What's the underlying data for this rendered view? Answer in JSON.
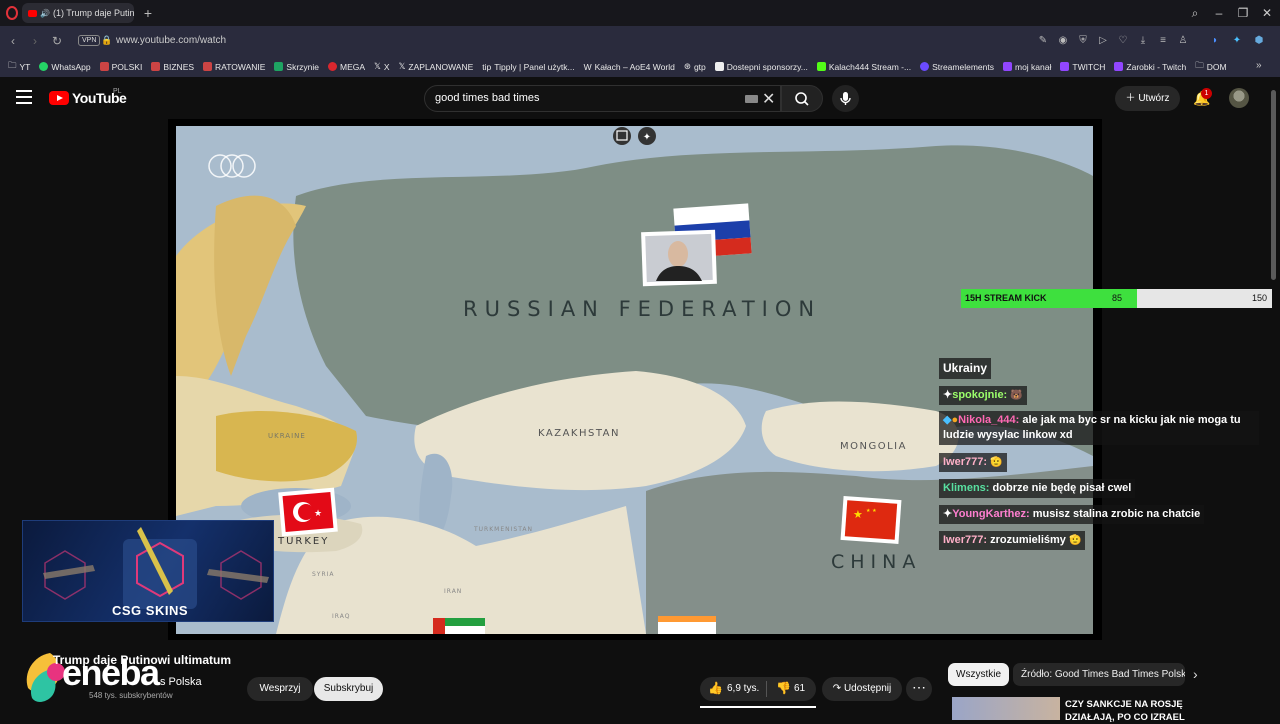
{
  "browser": {
    "tab_title": "(1) Trump daje Putino",
    "url": "www.youtube.com/watch",
    "vpn_label": "VPN",
    "bookmarks": [
      "YT",
      "WhatsApp",
      "POLSKI",
      "BIZNES",
      "RATOWANIE",
      "Skrzynie",
      "MEGA",
      "X",
      "ZAPLANOWANE",
      "Tipply | Panel użytk...",
      "Kałach – AoE4 World",
      "gtp",
      "Dostepni sponsorzy...",
      "Kalach444 Stream -...",
      "Streamelements",
      "moj kanał",
      "TWITCH",
      "Zarobki - Twitch",
      "DOM"
    ]
  },
  "youtube": {
    "logo_text": "YouTube",
    "region": "PL",
    "search_query": "good times bad times",
    "create_label": "Utwórz",
    "notification_count": "1"
  },
  "map": {
    "labels": {
      "russia": "RUSSIAN FEDERATION",
      "kazakhstan": "KAZAKHSTAN",
      "mongolia": "MONGOLIA",
      "china": "CHINA",
      "ukraine": "UKRAINE",
      "turkey": "TURKEY",
      "turkmenistan": "TURKMENISTAN",
      "syria": "SYRIA",
      "iran": "IRAN",
      "iraq": "IRAQ"
    }
  },
  "overlay": {
    "goal_label": "15H STREAM KICK",
    "goal_current": "85",
    "goal_max": "150",
    "goal_fraction": 0.567,
    "chat_title": "Ukrainy",
    "chat": [
      {
        "user": "spokojnie:",
        "msg": "",
        "color": "#9cff6b"
      },
      {
        "user": "Nikola_444:",
        "msg": "ale jak ma byc sr na kicku jak nie moga tu ludzie wysylac linkow xd",
        "color": "#ff69b4"
      },
      {
        "user": "Iwer777:",
        "msg": "",
        "color": "#ffb0c8"
      },
      {
        "user": "Klimens:",
        "msg": "dobrze nie będę pisał cwel",
        "color": "#58e0a0"
      },
      {
        "user": "YoungKarthez:",
        "msg": "musisz stalina zrobic na chatcie",
        "color": "#ff7fd0"
      },
      {
        "user": "Iwer777:",
        "msg": "zrozumieliśmy",
        "color": "#ffb0c8"
      }
    ],
    "sponsor": "CSG SKINS"
  },
  "video": {
    "title": "Trump daje Putinowi ultimatum",
    "channel": "s Polska",
    "subscribers": "548 tys. subskrybentów",
    "support_label": "Wesprzyj",
    "subscribe_label": "Subskrybuj",
    "likes": "6,9 tys.",
    "dislikes": "61",
    "share_label": "Udostępnij",
    "watermark": "eneba"
  },
  "sidebar": {
    "chip_all": "Wszystkie",
    "chip_source": "Źródło: Good Times Bad Times Polska",
    "suggestion_title": "CZY SANKCJE NA ROSJĘ DZIAŁAJĄ, PO CO IZRAEL"
  }
}
